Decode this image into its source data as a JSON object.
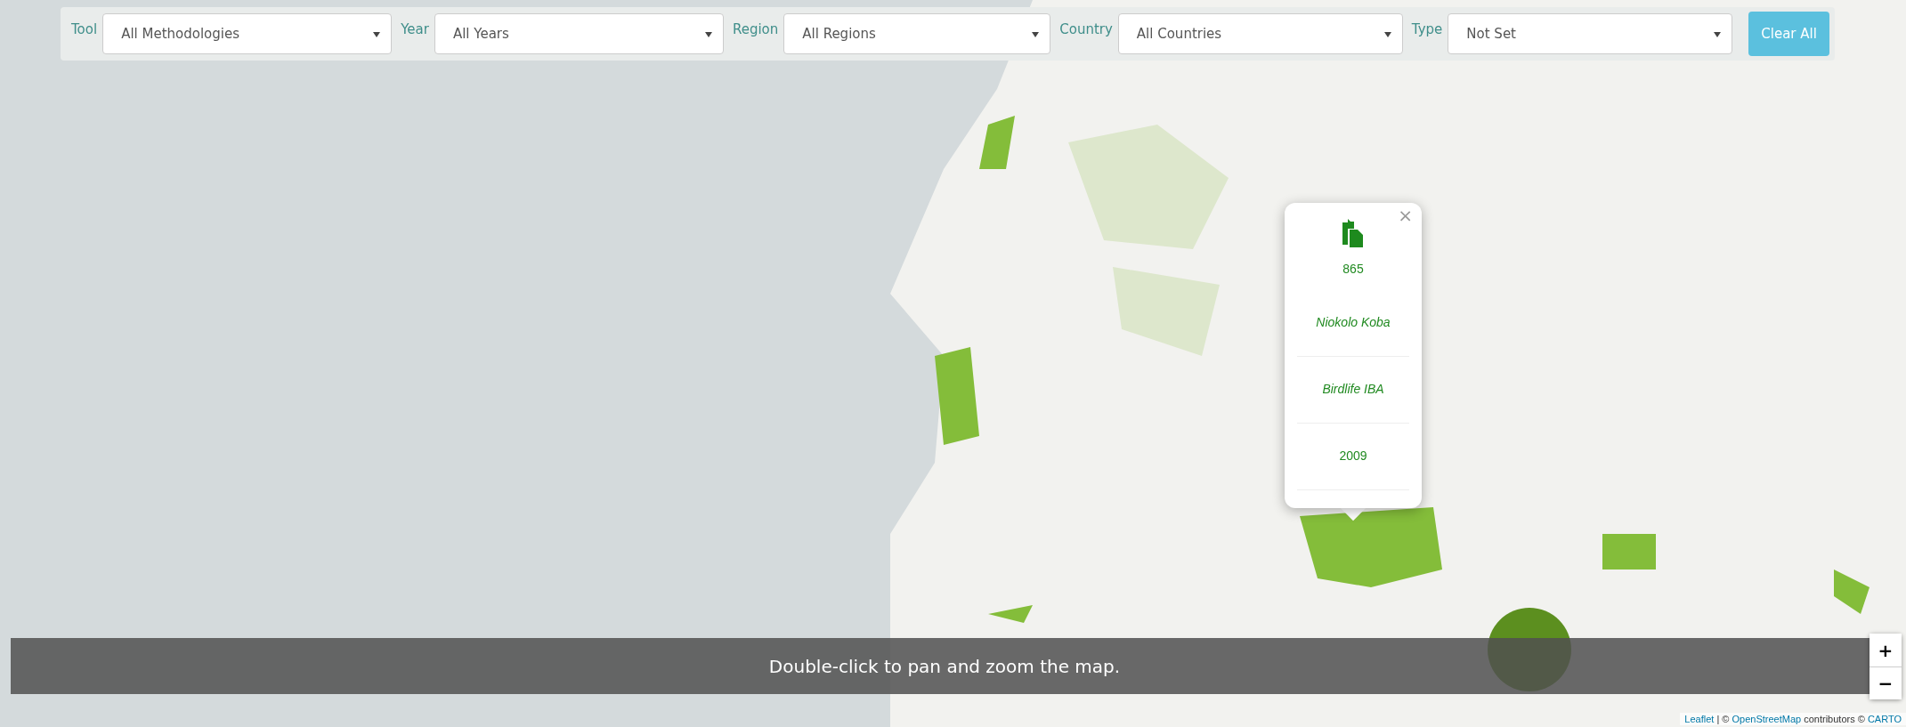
{
  "filters": [
    {
      "label": "Tool",
      "value": "All Methodologies"
    },
    {
      "label": "Year",
      "value": "All Years"
    },
    {
      "label": "Region",
      "value": "All Regions"
    },
    {
      "label": "Country",
      "value": "All Countries"
    },
    {
      "label": "Type",
      "value": "Not Set"
    }
  ],
  "clear_button": "Clear All",
  "popup": {
    "close": "×",
    "items": [
      {
        "kind": "plain",
        "text": "865"
      },
      {
        "kind": "italic",
        "text": "Niokolo Koba"
      },
      {
        "kind": "italic",
        "text": "Birdlife IBA"
      },
      {
        "kind": "plain",
        "text": "2009"
      }
    ]
  },
  "map_hint": "Double-click to pan and zoom the map.",
  "zoom_controls": [
    "+",
    "−"
  ],
  "attribution": [
    {
      "kind": "link",
      "text": "Leaflet"
    },
    {
      "kind": "text",
      "text": " | © "
    },
    {
      "kind": "link",
      "text": "OpenStreetMap"
    },
    {
      "kind": "text",
      "text": " contributors © "
    },
    {
      "kind": "link",
      "text": "CARTO"
    }
  ]
}
